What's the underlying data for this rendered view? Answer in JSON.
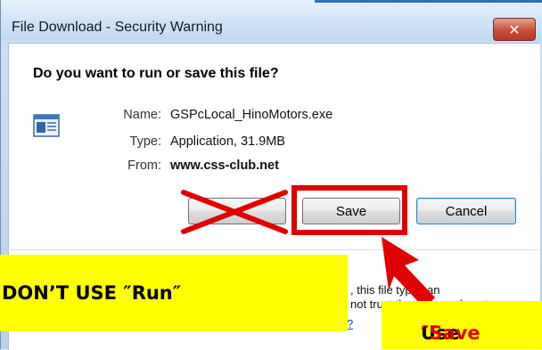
{
  "window": {
    "title": "File Download - Security Warning",
    "close_glyph": "✕"
  },
  "dialog": {
    "question": "Do you want to run or save this file?",
    "fields": {
      "name_label": "Name:",
      "name_value": "GSPcLocal_HinoMotors.exe",
      "type_label": "Type:",
      "type_value": "Application, 31.9MB",
      "from_label": "From:",
      "from_value": "www.css-club.net"
    },
    "buttons": {
      "save_label": "Save",
      "cancel_label": "Cancel"
    },
    "warning_line1": ", this file type can",
    "warning_line2": "not trust the source, do not",
    "warning_link": "?"
  },
  "annotations": {
    "left_banner": "DON’T USE ″Run″",
    "right_banner_prefix": "Use ",
    "right_banner_highlight": "″Save",
    "color_highlight": "#e00000",
    "color_banner": "#ffff00"
  }
}
